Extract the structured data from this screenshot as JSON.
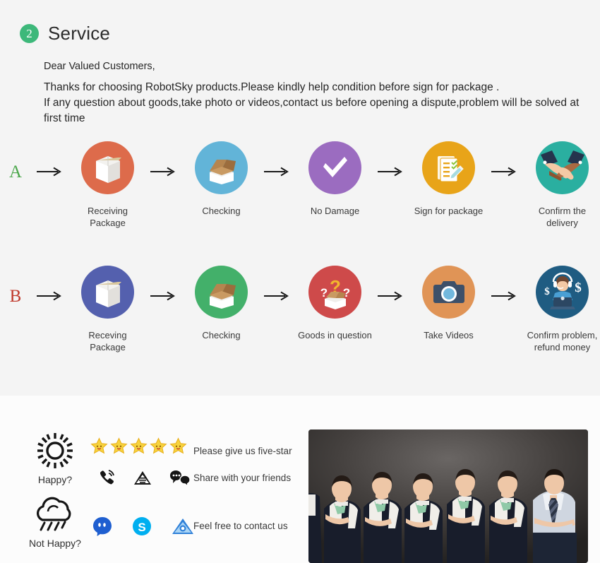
{
  "service": {
    "badge_number": "2",
    "title": "Service",
    "greeting": "Dear Valued Customers,",
    "body": "Thanks for choosing RobotSky products.Please kindly help condition before sign for package .\nIf any question about goods,take photo or videos,contact us before opening a dispute,problem will be solved at first time"
  },
  "flows": [
    {
      "letter": "A",
      "letter_color": "#4aa64a",
      "steps": [
        {
          "label": "Receiving Package",
          "icon": "sealed-box-icon",
          "circle_color": "#dd6b4b"
        },
        {
          "label": "Checking",
          "icon": "open-box-icon",
          "circle_color": "#62b4d8"
        },
        {
          "label": "No Damage",
          "icon": "checkmark-icon",
          "circle_color": "#9b6cc0"
        },
        {
          "label": "Sign for package",
          "icon": "signature-document-icon",
          "circle_color": "#e8a419"
        },
        {
          "label": "Confirm the delivery",
          "icon": "handshake-icon",
          "circle_color": "#2aafa0"
        }
      ]
    },
    {
      "letter": "B",
      "letter_color": "#c0392b",
      "steps": [
        {
          "label": "Receving Package",
          "icon": "sealed-box-icon",
          "circle_color": "#5460ae"
        },
        {
          "label": "Checking",
          "icon": "open-box-icon",
          "circle_color": "#43b06a"
        },
        {
          "label": "Goods in question",
          "icon": "question-box-icon",
          "circle_color": "#ce4a4a"
        },
        {
          "label": "Take Videos",
          "icon": "camera-icon",
          "circle_color": "#e09456"
        },
        {
          "label": "Confirm problem,\nrefund money",
          "icon": "support-agent-money-icon",
          "circle_color": "#1f5c82"
        }
      ]
    }
  ],
  "contact": {
    "moods": [
      {
        "label": "Happy?",
        "icon": "sun-icon"
      },
      {
        "label": "Not Happy?",
        "icon": "rain-cloud-icon"
      }
    ],
    "stars_count": 5,
    "star_icon": "star-smiley-icon",
    "social_row_1": [
      "phone-ringing-icon",
      "envelope-icon",
      "chat-bubbles-icon"
    ],
    "social_row_2": [
      "messenger-icon",
      "skype-icon",
      "email-envelope-icon"
    ],
    "messages": [
      "Please give us five-star",
      "Share with your friends",
      "Feel free to contact us"
    ],
    "photo_alt": "customer-service-team-photo"
  },
  "colors": {
    "section_bg": "#f4f4f4",
    "contact_bg": "#fcfcfc",
    "badge_green": "#3db87a",
    "star_gold": "#f5c518",
    "skype_blue": "#00aff0"
  }
}
